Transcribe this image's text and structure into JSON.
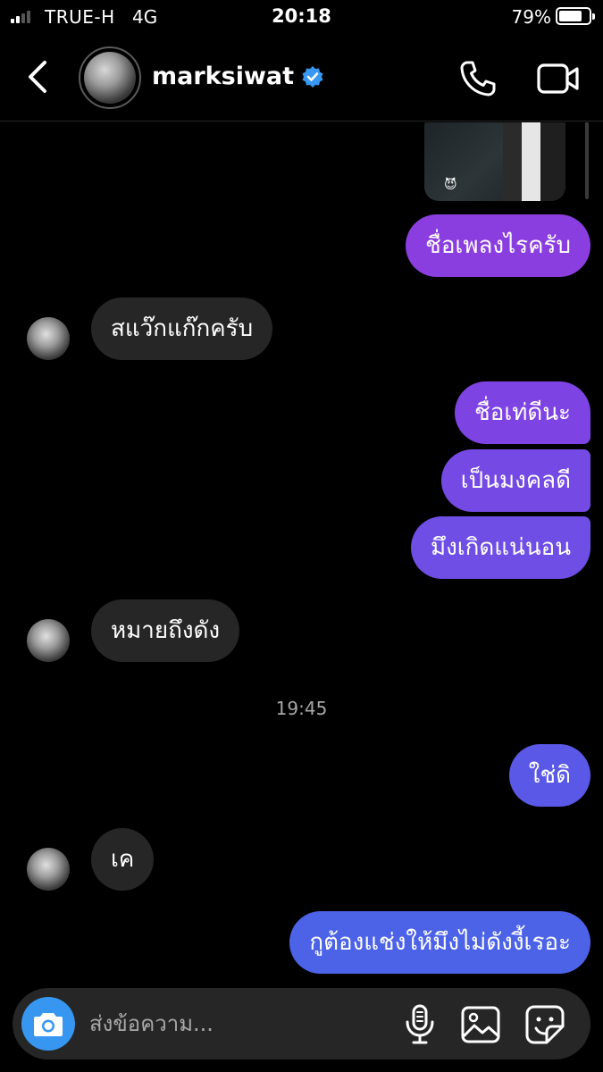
{
  "status_bar": {
    "carrier": "TRUE-H",
    "network": "4G",
    "time": "20:18",
    "battery_percent": "79%",
    "battery_level": 0.79
  },
  "header": {
    "username": "marksiwat",
    "verified": true,
    "icons": [
      "chevron-left-icon",
      "verified-badge-icon",
      "phone-icon",
      "video-camera-icon"
    ]
  },
  "chat": {
    "timestamp": "19:45",
    "messages": [
      {
        "direction": "out",
        "text": "ชื่อเพลงไรครับ"
      },
      {
        "direction": "in",
        "text": "สแว๊กแก๊กครับ"
      },
      {
        "direction": "out",
        "text": "ชื่อเท่ดีนะ"
      },
      {
        "direction": "out",
        "text": "เป็นมงคลดี"
      },
      {
        "direction": "out",
        "text": "มึงเกิดแน่นอน"
      },
      {
        "direction": "in",
        "text": "หมายถึงดัง"
      },
      {
        "direction": "out",
        "text": "ใช่ดิ"
      },
      {
        "direction": "in",
        "text": "เค"
      },
      {
        "direction": "out",
        "text": "กูต้องแช่งให้มึงไม่ดังงี้เรอะ"
      }
    ]
  },
  "composer": {
    "placeholder": "ส่งข้อความ...",
    "icons": [
      "camera-icon",
      "microphone-icon",
      "gallery-icon",
      "sticker-icon"
    ],
    "accent": "#3797f0"
  },
  "colors": {
    "incoming_bubble": "#262626",
    "outgoing_gradient_top": "#8a3ee0",
    "outgoing_gradient_bottom": "#4a64e6",
    "verified_badge": "#3897f0"
  }
}
